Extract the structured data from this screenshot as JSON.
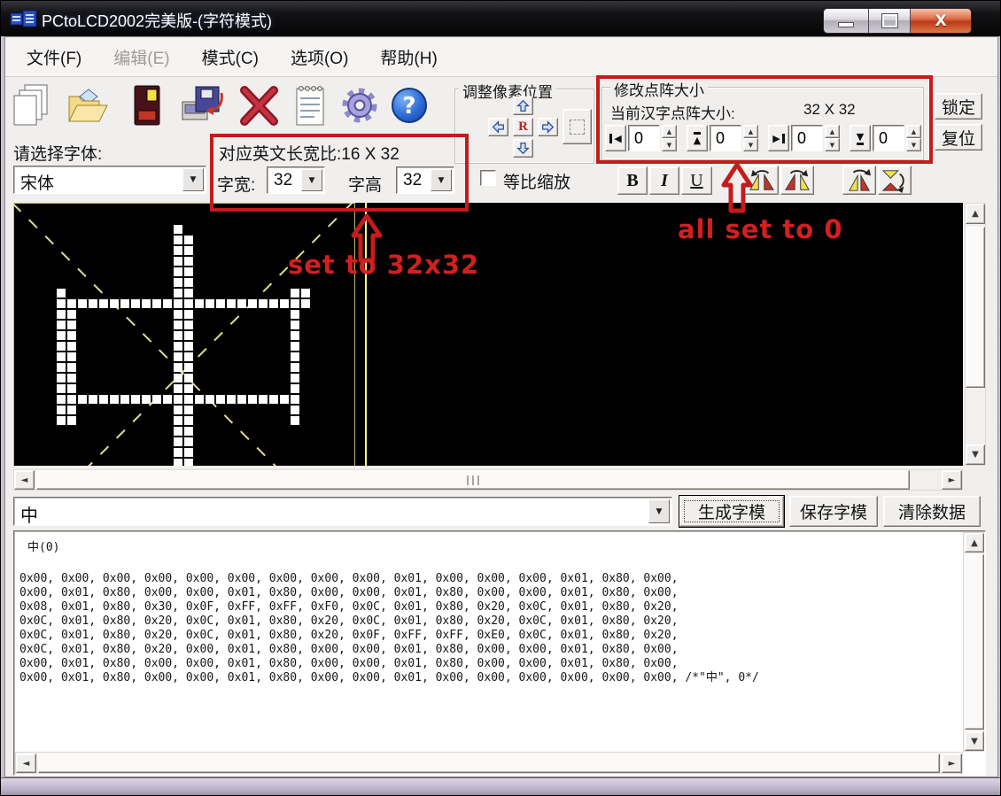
{
  "window": {
    "title": "PCtoLCD2002完美版-(字符模式)"
  },
  "menu": {
    "items": [
      {
        "label": "文件(F)",
        "enabled": true
      },
      {
        "label": "编辑(E)",
        "enabled": false
      },
      {
        "label": "模式(C)",
        "enabled": true
      },
      {
        "label": "选项(O)",
        "enabled": true
      },
      {
        "label": "帮助(H)",
        "enabled": true
      }
    ]
  },
  "toolbar": {
    "icons": [
      "new-file",
      "open-file",
      "save",
      "save-module",
      "delete",
      "report",
      "settings",
      "help"
    ]
  },
  "font_picker": {
    "label": "请选择字体:",
    "value": "宋体"
  },
  "char_size": {
    "ratio_label": "对应英文长宽比:16 X 32",
    "width_label": "字宽:",
    "width_value": "32",
    "height_label": "字高",
    "height_value": "32"
  },
  "scale_checkbox": {
    "label": "等比缩放",
    "checked": false
  },
  "pixel_position": {
    "title": "调整像素位置",
    "center_label": "R"
  },
  "matrix_size": {
    "title": "修改点阵大小",
    "current_label": "当前汉字点阵大小:",
    "current_value": "32 X 32",
    "spinners": [
      {
        "name": "left",
        "value": "0"
      },
      {
        "name": "top",
        "value": "0"
      },
      {
        "name": "right",
        "value": "0"
      },
      {
        "name": "bottom",
        "value": "0"
      }
    ]
  },
  "side_buttons": {
    "lock": "锁定",
    "reset": "复位"
  },
  "format_toolbar": {
    "bold": "B",
    "italic": "I",
    "underline": "U"
  },
  "annotations": {
    "set_size": "set to 32x32",
    "all_zero": "all set to 0",
    "color": "#c41b1b"
  },
  "canvas": {
    "columns": 32,
    "rows": 32
  },
  "char_row": {
    "input_value": "中",
    "generate": "生成字模",
    "save": "保存字模",
    "clear": "清除数据"
  },
  "output": {
    "header": "中(0)",
    "lines": [
      "0x00, 0x00, 0x00, 0x00, 0x00, 0x00, 0x00, 0x00, 0x00, 0x01, 0x00, 0x00, 0x00, 0x01, 0x80, 0x00,",
      "0x00, 0x01, 0x80, 0x00, 0x00, 0x01, 0x80, 0x00, 0x00, 0x01, 0x80, 0x00, 0x00, 0x01, 0x80, 0x00,",
      "0x08, 0x01, 0x80, 0x30, 0x0F, 0xFF, 0xFF, 0xF0, 0x0C, 0x01, 0x80, 0x20, 0x0C, 0x01, 0x80, 0x20,",
      "0x0C, 0x01, 0x80, 0x20, 0x0C, 0x01, 0x80, 0x20, 0x0C, 0x01, 0x80, 0x20, 0x0C, 0x01, 0x80, 0x20,",
      "0x0C, 0x01, 0x80, 0x20, 0x0C, 0x01, 0x80, 0x20, 0x0F, 0xFF, 0xFF, 0xE0, 0x0C, 0x01, 0x80, 0x20,",
      "0x0C, 0x01, 0x80, 0x20, 0x00, 0x01, 0x80, 0x00, 0x00, 0x01, 0x80, 0x00, 0x00, 0x01, 0x80, 0x00,",
      "0x00, 0x01, 0x80, 0x00, 0x00, 0x01, 0x80, 0x00, 0x00, 0x01, 0x80, 0x00, 0x00, 0x01, 0x80, 0x00,",
      "0x00, 0x01, 0x80, 0x00, 0x00, 0x01, 0x80, 0x00, 0x00, 0x01, 0x00, 0x00, 0x00, 0x00, 0x00, 0x00, /*\"中\", 0*/"
    ]
  },
  "colors": {
    "annotation_red": "#c41b1b",
    "canvas_guide_yellow": "#e8e896",
    "canvas_bg": "#000000",
    "pixel_on": "#ffffff"
  }
}
